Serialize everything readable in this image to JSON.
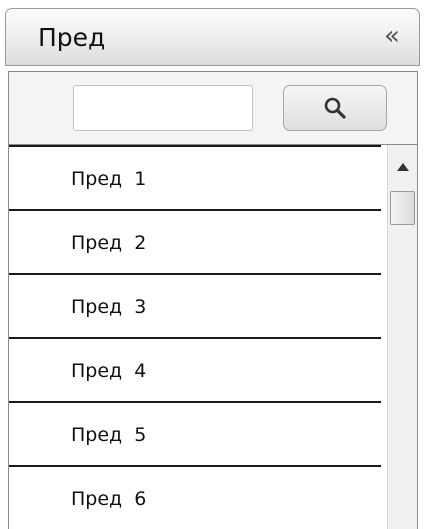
{
  "header": {
    "title": "Пред",
    "collapse_glyph": "«",
    "collapse_icon": "double-chevron-left-icon"
  },
  "search": {
    "value": "",
    "placeholder": "",
    "button_icon": "search-icon"
  },
  "list": {
    "items": [
      {
        "label": "Пред  1"
      },
      {
        "label": "Пред  2"
      },
      {
        "label": "Пред  3"
      },
      {
        "label": "Пред  4"
      },
      {
        "label": "Пред  5"
      },
      {
        "label": "Пред  6"
      }
    ]
  },
  "scrollbar": {
    "up_icon": "triangle-up-icon"
  },
  "colors": {
    "header_gradient_top": "#fbfbfb",
    "header_gradient_bottom": "#dcdcdc",
    "border": "#8a8a8a",
    "divider": "#1a1a1a",
    "icon": "#333333"
  }
}
